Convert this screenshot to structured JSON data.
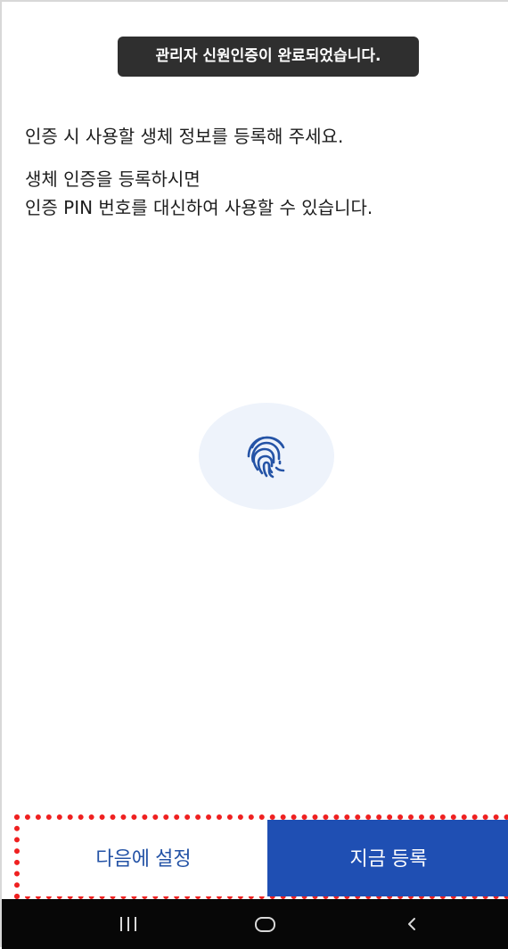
{
  "toast": {
    "message": "관리자 신원인증이 완료되었습니다."
  },
  "content": {
    "instruction": "인증 시 사용할 생체 정보를 등록해 주세요.",
    "description_line1": "생체 인증을 등록하시면",
    "description_line2": "인증 PIN 번호를 대신하여 사용할 수 있습니다."
  },
  "icons": {
    "fingerprint": "fingerprint-icon"
  },
  "buttons": {
    "later": "다음에 설정",
    "now": "지금 등록"
  },
  "colors": {
    "primary": "#1f4fb3",
    "later_text": "#2453a6",
    "toast_bg": "#2f2f2f",
    "fingerprint_bg": "#eef3fb",
    "highlight_outline": "#ef2020"
  }
}
